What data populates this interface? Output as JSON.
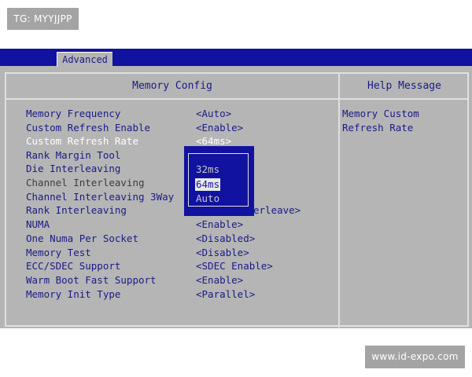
{
  "watermarks": {
    "top_left": "TG: MYYJJPP",
    "bottom_right": "www.id-expo.com"
  },
  "tab": {
    "label": "Advanced"
  },
  "panel": {
    "title": "Memory Config",
    "help_title": "Help Message",
    "help_lines": [
      "Memory Custom",
      "Refresh Rate"
    ]
  },
  "rows": [
    {
      "label": "Memory Frequency",
      "value": "<Auto>"
    },
    {
      "label": "Custom Refresh Enable",
      "value": "<Enable>"
    },
    {
      "label": "Custom Refresh Rate",
      "value": "<64ms>"
    },
    {
      "label": "Rank Margin Tool",
      "value": ""
    },
    {
      "label": "Die Interleaving",
      "value": ""
    },
    {
      "label": "Channel Interleaving",
      "value": ""
    },
    {
      "label": "Channel Interleaving 3Way",
      "value": ""
    },
    {
      "label": "Rank Interleaving",
      "value": "erleave>"
    },
    {
      "label": "NUMA",
      "value": "<Enable>"
    },
    {
      "label": "One Numa Per Socket",
      "value": "<Disabled>"
    },
    {
      "label": "Memory Test",
      "value": "<Disable>"
    },
    {
      "label": "ECC/SDEC Support",
      "value": "<SDEC Enable>"
    },
    {
      "label": "Warm Boot Fast Support",
      "value": "<Enable>"
    },
    {
      "label": "Memory Init Type",
      "value": "<Parallel>"
    }
  ],
  "popup": {
    "options": [
      "32ms",
      "64ms",
      "Auto"
    ],
    "selected": "64ms"
  },
  "colors": {
    "bios_blue": "#1212a0",
    "bios_gray": "#b5b5b5",
    "text_blue": "#1a1a86",
    "highlight": "#ffffff"
  }
}
